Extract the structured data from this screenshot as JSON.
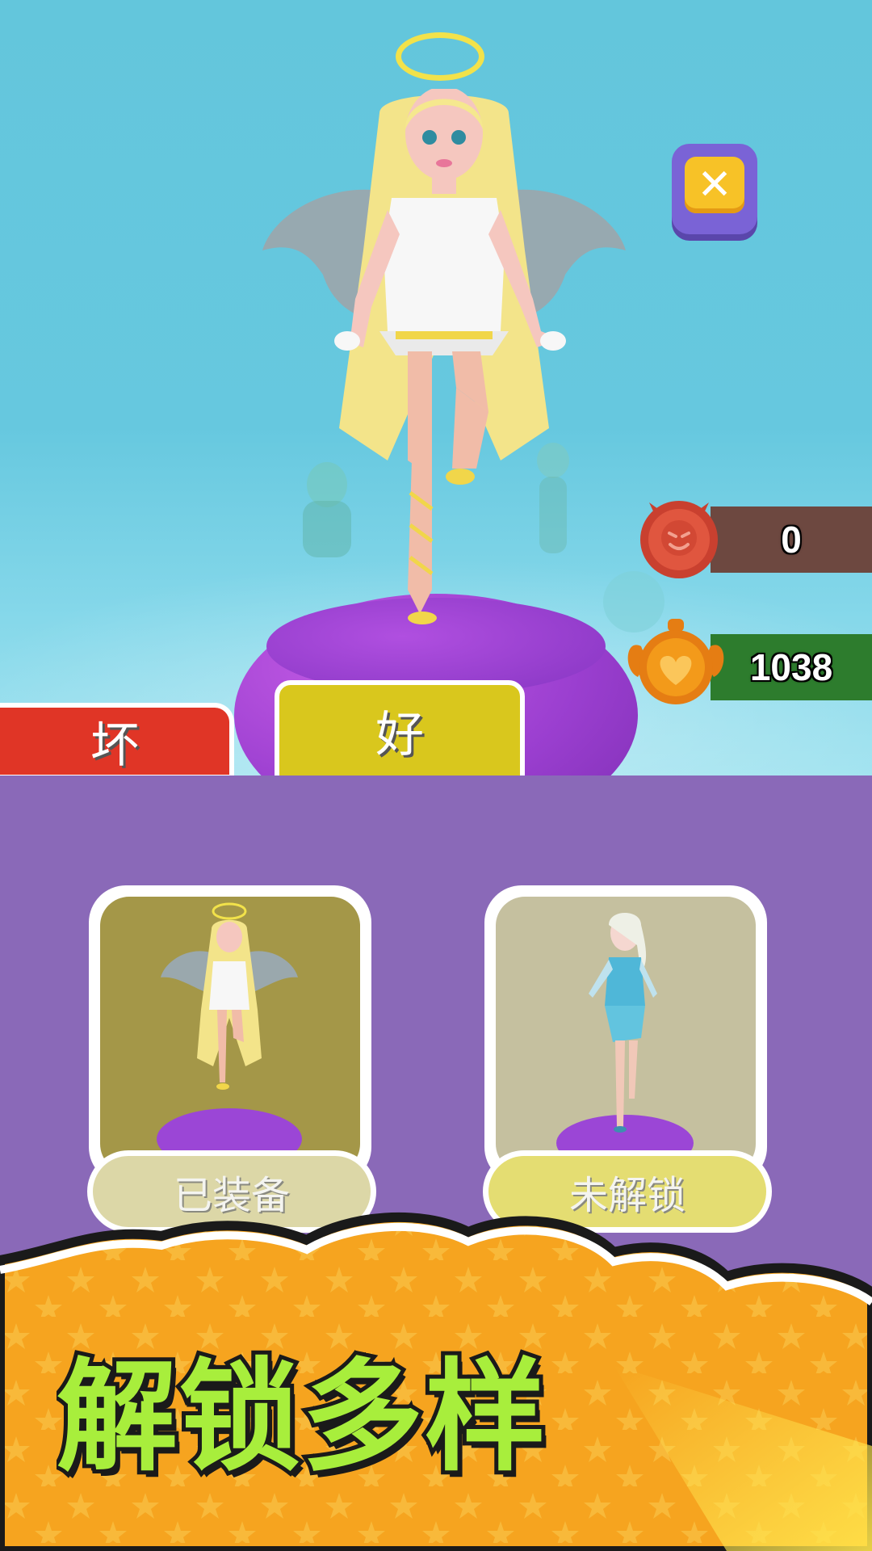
{
  "hud": {
    "close_icon": "close-icon",
    "bad_counter": {
      "icon": "devil-face-icon",
      "value": "0",
      "color": "#e0563f"
    },
    "good_counter": {
      "icon": "angel-heart-icon",
      "value": "1038",
      "color": "#f39a1a"
    }
  },
  "tabs": {
    "bad_label": "坏",
    "good_label": "好"
  },
  "outfits": [
    {
      "name": "angel",
      "status": "已装备"
    },
    {
      "name": "ice-princess",
      "status": "未解锁"
    }
  ],
  "banner": {
    "title": "解锁多样"
  },
  "colors": {
    "scene_bg": "#63c6dc",
    "panel_bg": "#8a69b8",
    "bad_tab": "#e03526",
    "good_tab": "#d9c71d",
    "banner_orange": "#f6a41f",
    "banner_text": "#a8ee3c"
  }
}
